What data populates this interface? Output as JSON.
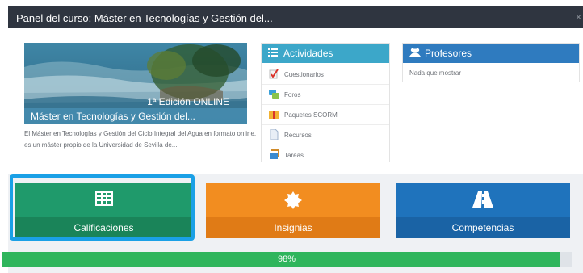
{
  "window": {
    "title": "Panel del curso: Máster en Tecnologías y Gestión del...",
    "close_label": "×"
  },
  "course": {
    "edition": "1ª Edición ONLINE",
    "name": "Máster en Tecnologías y Gestión del...",
    "description": "El Máster en Tecnologías y Gestión del Ciclo Integral del Agua en formato online, es un máster propio de la Universidad de Sevilla de..."
  },
  "activities": {
    "title": "Actividades",
    "icon": "list-icon",
    "items": [
      {
        "label": "Cuestionarios",
        "icon": "quiz-icon"
      },
      {
        "label": "Foros",
        "icon": "forum-icon"
      },
      {
        "label": "Paquetes SCORM",
        "icon": "scorm-package-icon"
      },
      {
        "label": "Recursos",
        "icon": "resource-file-icon"
      },
      {
        "label": "Tareas",
        "icon": "assignment-icon"
      }
    ]
  },
  "teachers": {
    "title": "Profesores",
    "icon": "users-icon",
    "empty_text": "Nada que mostrar"
  },
  "tiles": [
    {
      "label": "Calificaciones",
      "icon": "grades-table-icon",
      "color": "#1f9a6b",
      "selected": true
    },
    {
      "label": "Insignias",
      "icon": "badge-icon",
      "color": "#f28d20"
    },
    {
      "label": "Competencias",
      "icon": "road-icon",
      "color": "#1f73bc"
    }
  ],
  "progress": {
    "value": 98,
    "label": "98%",
    "color": "#2fb55c"
  }
}
